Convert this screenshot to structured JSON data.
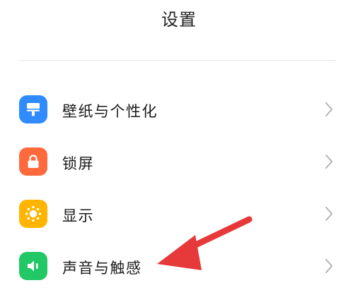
{
  "header": {
    "title": "设置"
  },
  "settings": {
    "items": [
      {
        "label": "壁纸与个性化",
        "icon": "wallpaper-brush-icon",
        "color": "#2f8bff"
      },
      {
        "label": "锁屏",
        "icon": "lock-icon",
        "color": "#ff6a3d"
      },
      {
        "label": "显示",
        "icon": "sun-icon",
        "color": "#ffb400"
      },
      {
        "label": "声音与触感",
        "icon": "speaker-icon",
        "color": "#22c766"
      }
    ]
  },
  "annotation": {
    "arrow_color": "#e63a3a"
  }
}
